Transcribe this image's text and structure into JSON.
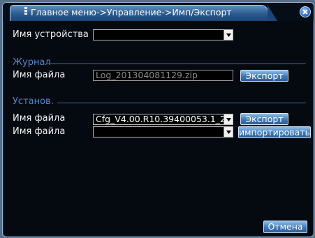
{
  "window": {
    "title": "Главное меню->Управление->Имп/Экспорт"
  },
  "device": {
    "label": "Имя устройства",
    "value": ""
  },
  "log_section": {
    "title": "Журнал",
    "file_label": "Имя файла",
    "file_value": "Log_201304081129.zip",
    "export_label": "Экспорт"
  },
  "settings_section": {
    "title": "Установ.",
    "export_file_label": "Имя файла",
    "export_file_value": "Cfg_V4.00.R10.39400053.1_2",
    "export_label": "Экспорт",
    "import_file_label": "Имя файла",
    "import_file_value": "",
    "import_label": "импортировать"
  },
  "footer": {
    "cancel_label": "Отмена"
  },
  "icons": {
    "title": "menu-icon",
    "close": "close-icon",
    "dropdown": "chevron-down-icon"
  },
  "colors": {
    "background": "#040a10",
    "accent": "#3f78b4",
    "section_title": "#4f86c9"
  }
}
